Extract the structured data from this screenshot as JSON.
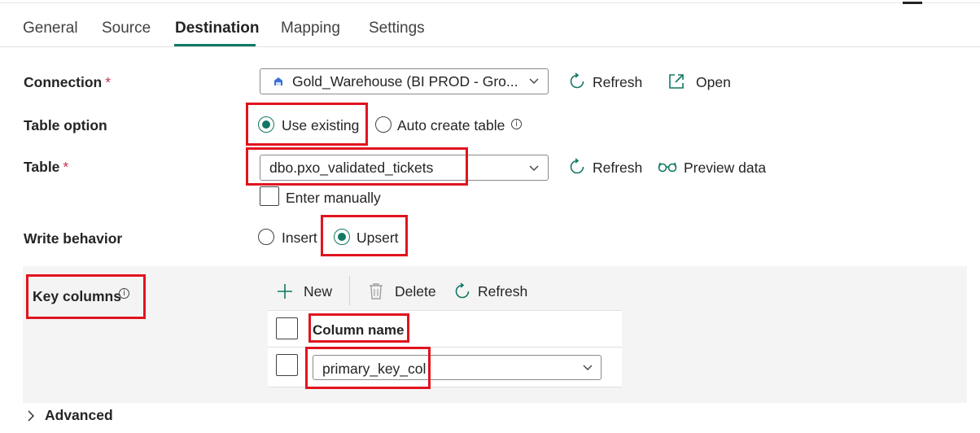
{
  "tabs": [
    {
      "label": "General"
    },
    {
      "label": "Source"
    },
    {
      "label": "Destination"
    },
    {
      "label": "Mapping"
    },
    {
      "label": "Settings"
    }
  ],
  "connection": {
    "label": "Connection",
    "required_mark": "*",
    "value": "Gold_Warehouse (BI PROD - Gro...",
    "refresh_label": "Refresh",
    "open_label": "Open"
  },
  "table_option": {
    "label": "Table option",
    "options": [
      "Use existing",
      "Auto create table"
    ],
    "selected": "Use existing"
  },
  "table": {
    "label": "Table",
    "required_mark": "*",
    "value": "dbo.pxo_validated_tickets",
    "refresh_label": "Refresh",
    "preview_label": "Preview data",
    "enter_manually_label": "Enter manually"
  },
  "write_behavior": {
    "label": "Write behavior",
    "options": [
      "Insert",
      "Upsert"
    ],
    "selected": "Upsert"
  },
  "key_columns": {
    "label": "Key columns",
    "toolbar": {
      "new": "New",
      "delete": "Delete",
      "refresh": "Refresh"
    },
    "header": "Column name",
    "rows": [
      {
        "value": "primary_key_col"
      }
    ]
  },
  "advanced": {
    "label": "Advanced"
  },
  "colors": {
    "accent": "#117865",
    "highlight": "#e0141e",
    "required": "#c4314b"
  }
}
